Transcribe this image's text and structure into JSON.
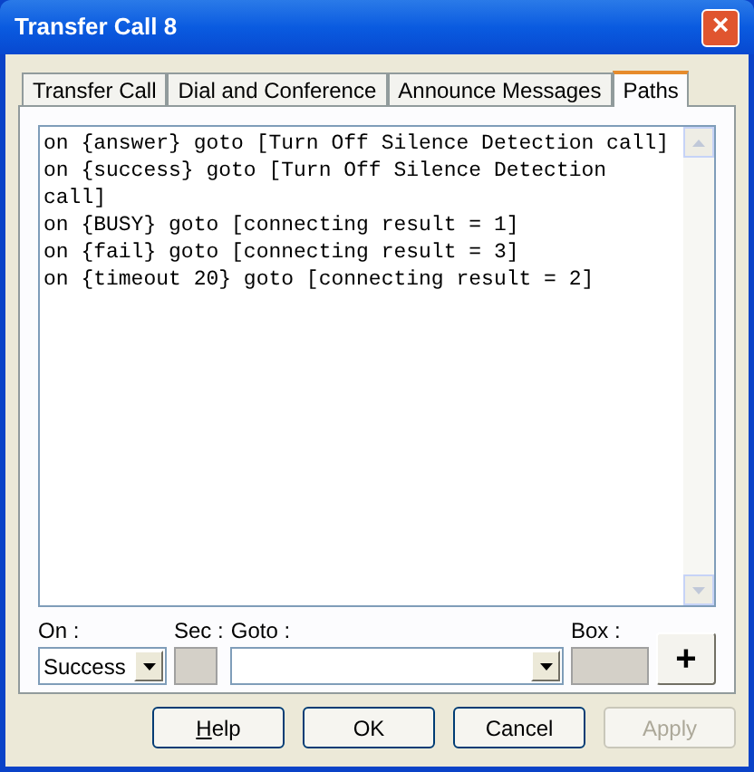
{
  "window": {
    "title": "Transfer Call 8",
    "close": "×"
  },
  "tabs": [
    {
      "label": "Transfer Call",
      "selected": false
    },
    {
      "label": "Dial and Conference",
      "selected": false
    },
    {
      "label": "Announce Messages",
      "selected": false
    },
    {
      "label": "Paths",
      "selected": true
    }
  ],
  "paths_list": [
    "on {answer} goto [Turn Off Silence Detection call]",
    "on {success} goto [Turn Off Silence Detection call]",
    "on {BUSY} goto [connecting result = 1]",
    "on {fail} goto [connecting result = 3]",
    "on {timeout 20} goto [connecting result = 2]"
  ],
  "editor": {
    "on_label": "On :",
    "on_value": "Success",
    "sec_label": "Sec :",
    "goto_label": "Goto :",
    "box_label": "Box :",
    "add_button": "+"
  },
  "buttons": [
    {
      "label": "Help",
      "underlined_first": true,
      "disabled": false
    },
    {
      "label": "OK",
      "disabled": false
    },
    {
      "label": "Cancel",
      "disabled": false
    },
    {
      "label": "Apply",
      "disabled": true
    }
  ]
}
